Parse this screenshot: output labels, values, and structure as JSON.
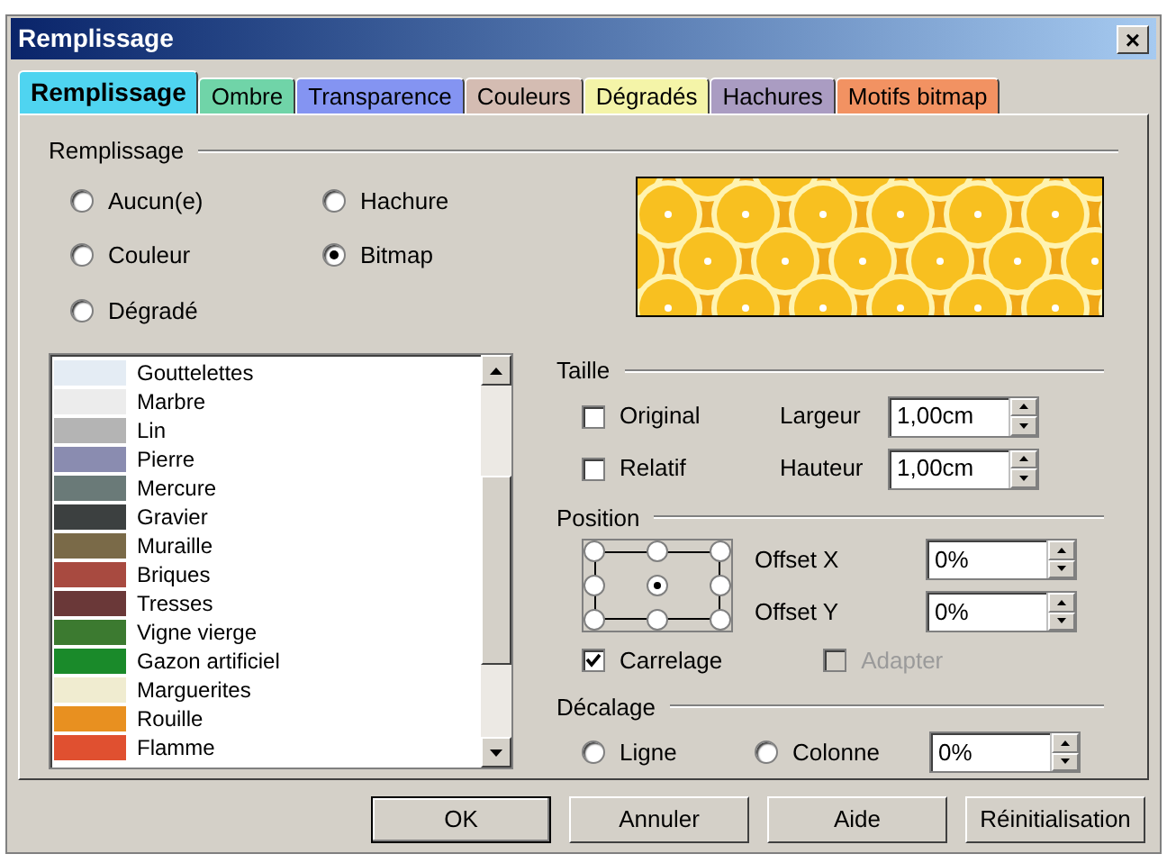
{
  "window": {
    "title": "Remplissage",
    "close": "×"
  },
  "tabs": [
    {
      "label": "Remplissage",
      "selected": true,
      "color": "#4fd4f0"
    },
    {
      "label": "Ombre",
      "selected": false,
      "color": "#70d4a8"
    },
    {
      "label": "Transparence",
      "selected": false,
      "color": "#8494f2"
    },
    {
      "label": "Couleurs",
      "selected": false,
      "color": "#d4bcb2"
    },
    {
      "label": "Dégradés",
      "selected": false,
      "color": "#f4f4a8"
    },
    {
      "label": "Hachures",
      "selected": false,
      "color": "#aa9cc2"
    },
    {
      "label": "Motifs bitmap",
      "selected": false,
      "color": "#f29262"
    }
  ],
  "fill": {
    "title": "Remplissage",
    "options": [
      {
        "label": "Aucun(e)",
        "selected": false
      },
      {
        "label": "Hachure",
        "selected": false
      },
      {
        "label": "Couleur",
        "selected": false
      },
      {
        "label": "Bitmap",
        "selected": true
      },
      {
        "label": "Dégradé",
        "selected": false
      }
    ]
  },
  "bitmaps": [
    {
      "label": "Gouttelettes",
      "color": "#e4ecf4"
    },
    {
      "label": "Marbre",
      "color": "#ececec"
    },
    {
      "label": "Lin",
      "color": "#b4b4b4"
    },
    {
      "label": "Pierre",
      "color": "#8a8cb0"
    },
    {
      "label": "Mercure",
      "color": "#6a7a78"
    },
    {
      "label": "Gravier",
      "color": "#3c4040"
    },
    {
      "label": "Muraille",
      "color": "#7a6a48"
    },
    {
      "label": "Briques",
      "color": "#a84a40"
    },
    {
      "label": "Tresses",
      "color": "#6a3838"
    },
    {
      "label": "Vigne vierge",
      "color": "#3c7a30"
    },
    {
      "label": "Gazon artificiel",
      "color": "#1a8a2a"
    },
    {
      "label": "Marguerites",
      "color": "#f0ecd0"
    },
    {
      "label": "Rouille",
      "color": "#e89020"
    },
    {
      "label": "Flamme",
      "color": "#e05030"
    }
  ],
  "size": {
    "title": "Taille",
    "original": {
      "label": "Original",
      "checked": false
    },
    "relative": {
      "label": "Relatif",
      "checked": false
    },
    "width": {
      "label": "Largeur",
      "value": "1,00cm"
    },
    "height": {
      "label": "Hauteur",
      "value": "1,00cm"
    }
  },
  "position": {
    "title": "Position",
    "anchors": [
      {
        "selected": false
      },
      {
        "selected": false
      },
      {
        "selected": false
      },
      {
        "selected": false
      },
      {
        "selected": true
      },
      {
        "selected": false
      },
      {
        "selected": false
      },
      {
        "selected": false
      },
      {
        "selected": false
      }
    ],
    "offset_x": {
      "label": "Offset X",
      "value": "0%"
    },
    "offset_y": {
      "label": "Offset Y",
      "value": "0%"
    },
    "tile": {
      "label": "Carrelage",
      "checked": true,
      "disabled": false
    },
    "fit": {
      "label": "Adapter",
      "checked": false,
      "disabled": true
    }
  },
  "offset": {
    "title": "Décalage",
    "options": [
      {
        "label": "Ligne",
        "selected": false
      },
      {
        "label": "Colonne",
        "selected": false
      }
    ],
    "value": "0%"
  },
  "buttons": [
    {
      "label": "OK",
      "default": true
    },
    {
      "label": "Annuler",
      "default": false
    },
    {
      "label": "Aide",
      "default": false
    },
    {
      "label": "Réinitialisation",
      "default": false
    }
  ]
}
